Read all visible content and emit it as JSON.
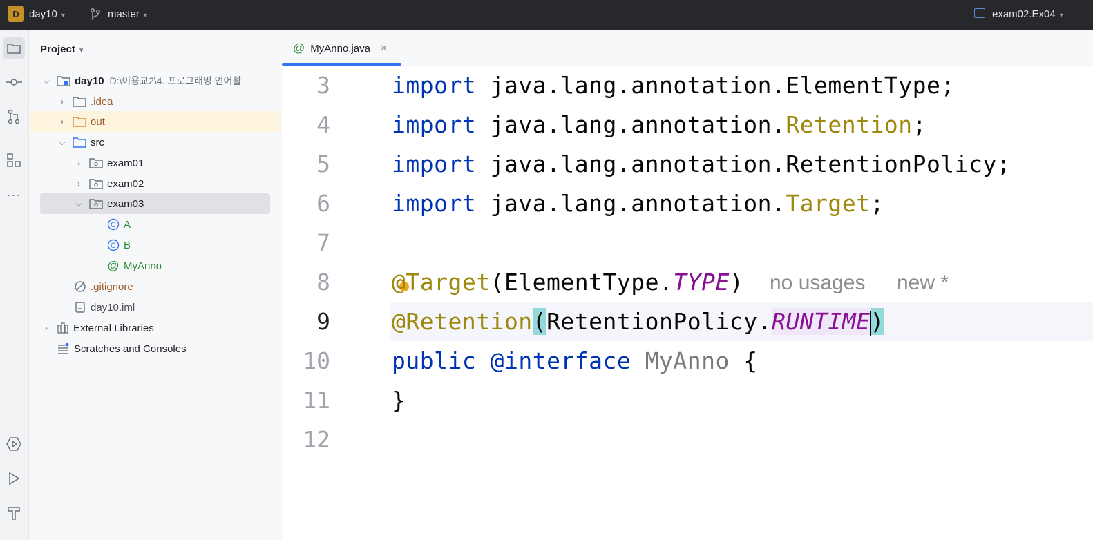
{
  "titlebar": {
    "project_initial": "D",
    "project_name": "day10",
    "branch": "master",
    "run_config": "exam02.Ex04"
  },
  "project_panel": {
    "title": "Project",
    "tree": [
      {
        "label": "day10",
        "path": "D:\\이용교2\\4. 프로그래밍 언어활",
        "kind": "module",
        "expanded": true
      },
      {
        "label": ".idea",
        "kind": "folder",
        "expanded": false
      },
      {
        "label": "out",
        "kind": "folder-excluded",
        "expanded": false
      },
      {
        "label": "src",
        "kind": "folder-source",
        "expanded": true
      },
      {
        "label": "exam01",
        "kind": "package",
        "expanded": false
      },
      {
        "label": "exam02",
        "kind": "package",
        "expanded": false
      },
      {
        "label": "exam03",
        "kind": "package",
        "expanded": true,
        "selected": true
      },
      {
        "label": "A",
        "kind": "class"
      },
      {
        "label": "B",
        "kind": "class"
      },
      {
        "label": "MyAnno",
        "kind": "annotation"
      },
      {
        "label": ".gitignore",
        "kind": "ignored-file"
      },
      {
        "label": "day10.iml",
        "kind": "file"
      },
      {
        "label": "External Libraries",
        "kind": "libraries",
        "expanded": false
      },
      {
        "label": "Scratches and Consoles",
        "kind": "scratches"
      }
    ]
  },
  "editor": {
    "tab": {
      "label": "MyAnno.java",
      "icon": "annotation-icon"
    },
    "line_numbers": [
      "3",
      "4",
      "5",
      "6",
      "7",
      "8",
      "9",
      "10",
      "11",
      "12"
    ],
    "current_line": "9",
    "code": {
      "l3": {
        "kw": "import",
        "rest": " java.lang.annotation.ElementType;"
      },
      "l4": {
        "kw": "import",
        "pkg": " java.lang.annotation.",
        "cls": "Retention",
        "end": ";"
      },
      "l5": {
        "kw": "import",
        "rest": " java.lang.annotation.RetentionPolicy;"
      },
      "l6": {
        "kw": "import",
        "pkg": " java.lang.annotation.",
        "cls": "Target",
        "end": ";"
      },
      "l8": {
        "ann": "@Target",
        "open": "(ElementType.",
        "enum": "TYPE",
        "close": ")"
      },
      "l9": {
        "ann": "@Retention",
        "open": "(",
        "mid": "RetentionPolicy.",
        "enum": "RUNTIME",
        "close": ")"
      },
      "l10": {
        "kw": "public",
        "kw2": "@interface",
        "name": "MyAnno",
        "brace": "{"
      },
      "l11": {
        "brace": "}"
      }
    },
    "hints": {
      "usages": "no usages",
      "author": "new *"
    }
  },
  "colors": {
    "keyword": "#0033b3",
    "annotation": "#9e880d",
    "enum_constant": "#871094",
    "brace_match": "#93d9d9",
    "tab_accent": "#3574f0"
  }
}
